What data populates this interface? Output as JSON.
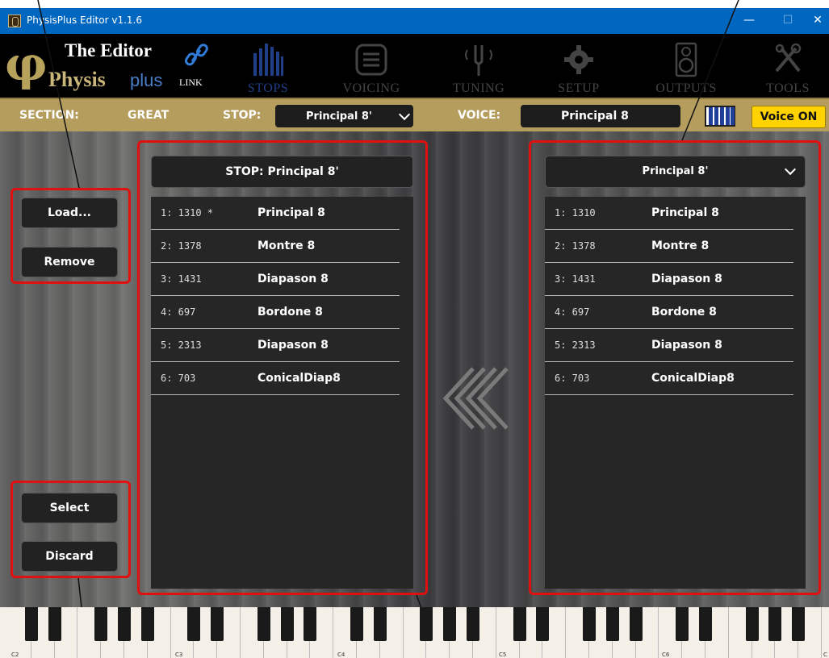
{
  "window": {
    "title": "PhysisPlus Editor v1.1.6",
    "minimize_glyph": "—",
    "maximize_glyph": "☐",
    "close_glyph": "✕"
  },
  "logo": {
    "phi": "φ",
    "editor": "The Editor",
    "physis": "Physis",
    "plus": "plus",
    "link_label": "LINK"
  },
  "nav": {
    "tabs": [
      {
        "label": "STOPS",
        "icon": "organ-pipes-icon",
        "active": true
      },
      {
        "label": "VOICING",
        "icon": "list-icon"
      },
      {
        "label": "TUNING",
        "icon": "tuning-fork-icon"
      },
      {
        "label": "SETUP",
        "icon": "gear-icon"
      },
      {
        "label": "OUTPUTS",
        "icon": "speaker-icon"
      },
      {
        "label": "TOOLS",
        "icon": "tools-icon"
      }
    ]
  },
  "section_bar": {
    "section_label": "SECTION:",
    "section_value": "GREAT",
    "stop_label": "STOP:",
    "stop_value": "Principal 8'",
    "voice_label": "VOICE:",
    "voice_value": "Principal 8",
    "voice_on_label": "Voice ON"
  },
  "left_buttons": {
    "load": "Load...",
    "remove": "Remove",
    "select": "Select",
    "discard": "Discard"
  },
  "stop_panel": {
    "header": "STOP: Principal 8'",
    "rows": [
      {
        "num": "1: 1310 *",
        "name": "Principal 8"
      },
      {
        "num": "2: 1378",
        "name": "Montre 8"
      },
      {
        "num": "3: 1431",
        "name": "Diapason 8"
      },
      {
        "num": "4: 697",
        "name": "Bordone 8"
      },
      {
        "num": "5: 2313",
        "name": "Diapason 8"
      },
      {
        "num": "6: 703",
        "name": "ConicalDiap8"
      }
    ]
  },
  "library_panel": {
    "dropdown_value": "Principal 8'",
    "rows": [
      {
        "num": "1: 1310",
        "name": "Principal 8"
      },
      {
        "num": "2: 1378",
        "name": "Montre 8"
      },
      {
        "num": "3: 1431",
        "name": "Diapason 8"
      },
      {
        "num": "4: 697",
        "name": "Bordone 8"
      },
      {
        "num": "5: 2313",
        "name": "Diapason 8"
      },
      {
        "num": "6: 703",
        "name": "ConicalDiap8"
      }
    ]
  },
  "keyboard": {
    "octave_labels": [
      "C2",
      "C3",
      "C4",
      "C5",
      "C6",
      "C"
    ]
  },
  "colors": {
    "titlebar": "#0067c0",
    "gold": "#b59d5d",
    "annotation_red": "#e01010",
    "voice_on": "#ffd200"
  }
}
